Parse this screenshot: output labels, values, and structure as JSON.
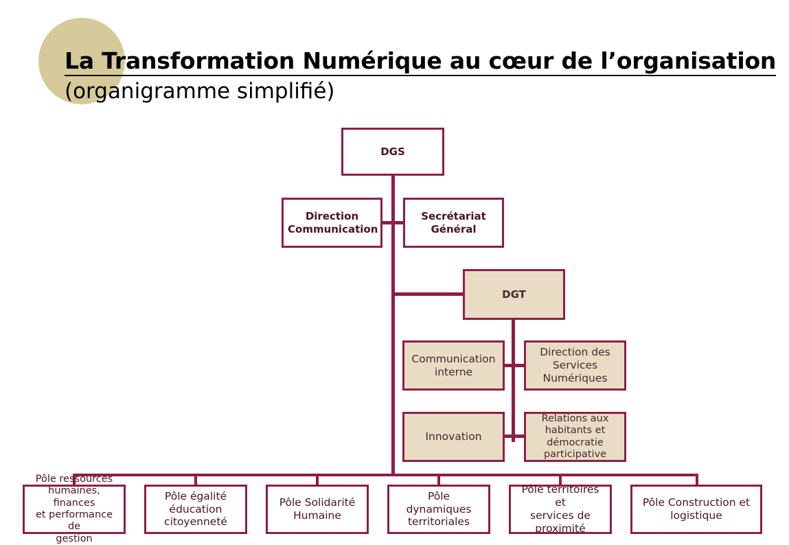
{
  "header": {
    "title_main": "La Transformation Numérique au cœur de l’organisation",
    "title_sub": "(organigramme simplifié)",
    "decoration": "tan-circle"
  },
  "colors": {
    "line": "#8e1f42",
    "box_border": "#8e1f42",
    "beige_fill": "#e8ddc4",
    "white_fill": "#ffffff",
    "circle": "#d6c99a",
    "text_dark": "#4a1228"
  },
  "chart_data": {
    "type": "diagram",
    "title": "La Transformation Numérique au cœur de l’organisation (organigramme simplifié)",
    "nodes": [
      {
        "id": "dgs",
        "label": "DGS",
        "style": "white",
        "weight": "bold"
      },
      {
        "id": "dircom",
        "label": "Direction\nCommunication",
        "style": "white",
        "weight": "bold"
      },
      {
        "id": "secgen",
        "label": "Secrétariat\nGénéral",
        "style": "white",
        "weight": "bold"
      },
      {
        "id": "dgt",
        "label": "DGT",
        "style": "beige",
        "weight": "bold"
      },
      {
        "id": "cominterne",
        "label": "Communication\ninterne",
        "style": "beige",
        "weight": "normal"
      },
      {
        "id": "dsn",
        "label": "Direction des\nServices\nNumériques",
        "style": "beige",
        "weight": "normal"
      },
      {
        "id": "innovation",
        "label": "Innovation",
        "style": "beige",
        "weight": "normal"
      },
      {
        "id": "relations",
        "label": "Relations aux\nhabitants et\ndémocratie\nparticipative",
        "style": "beige",
        "weight": "normal"
      },
      {
        "id": "pole1",
        "label": "Pôle ressources\nhumaines, finances\net performance de\ngestion",
        "style": "white",
        "weight": "normal"
      },
      {
        "id": "pole2",
        "label": "Pôle égalité\néducation\ncitoyenneté",
        "style": "white",
        "weight": "normal"
      },
      {
        "id": "pole3",
        "label": "Pôle Solidarité\nHumaine",
        "style": "white",
        "weight": "normal"
      },
      {
        "id": "pole4",
        "label": "Pôle dynamiques\nterritoriales",
        "style": "white",
        "weight": "normal"
      },
      {
        "id": "pole5",
        "label": "Pôle territoires et\nservices de\nproximité",
        "style": "white",
        "weight": "normal"
      },
      {
        "id": "pole6",
        "label": "Pôle Construction et\nlogistique",
        "style": "white",
        "weight": "normal"
      }
    ],
    "edges": [
      {
        "from": "dgs",
        "to": "dircom"
      },
      {
        "from": "dgs",
        "to": "secgen"
      },
      {
        "from": "dgs",
        "to": "dgt"
      },
      {
        "from": "dgt",
        "to": "cominterne"
      },
      {
        "from": "dgt",
        "to": "dsn"
      },
      {
        "from": "dgt",
        "to": "innovation"
      },
      {
        "from": "dgt",
        "to": "relations"
      },
      {
        "from": "dgs",
        "to": "pole1"
      },
      {
        "from": "dgs",
        "to": "pole2"
      },
      {
        "from": "dgs",
        "to": "pole3"
      },
      {
        "from": "dgs",
        "to": "pole4"
      },
      {
        "from": "dgs",
        "to": "pole5"
      },
      {
        "from": "dgs",
        "to": "pole6"
      }
    ]
  },
  "nodes": {
    "dgs": "DGS",
    "dircom_l1": "Direction",
    "dircom_l2": "Communication",
    "secgen_l1": "Secrétariat",
    "secgen_l2": "Général",
    "dgt": "DGT",
    "cominterne_l1": "Communication",
    "cominterne_l2": "interne",
    "dsn_l1": "Direction des",
    "dsn_l2": "Services",
    "dsn_l3": "Numériques",
    "innovation": "Innovation",
    "relations_l1": "Relations aux",
    "relations_l2": "habitants et",
    "relations_l3": "démocratie",
    "relations_l4": "participative",
    "pole1_l1": "Pôle ressources",
    "pole1_l2": "humaines, finances",
    "pole1_l3": "et performance de",
    "pole1_l4": "gestion",
    "pole2_l1": "Pôle égalité",
    "pole2_l2": "éducation",
    "pole2_l3": "citoyenneté",
    "pole3_l1": "Pôle Solidarité",
    "pole3_l2": "Humaine",
    "pole4_l1": "Pôle dynamiques",
    "pole4_l2": "territoriales",
    "pole5_l1": "Pôle territoires et",
    "pole5_l2": "services de",
    "pole5_l3": "proximité",
    "pole6_l1": "Pôle Construction et",
    "pole6_l2": "logistique"
  }
}
